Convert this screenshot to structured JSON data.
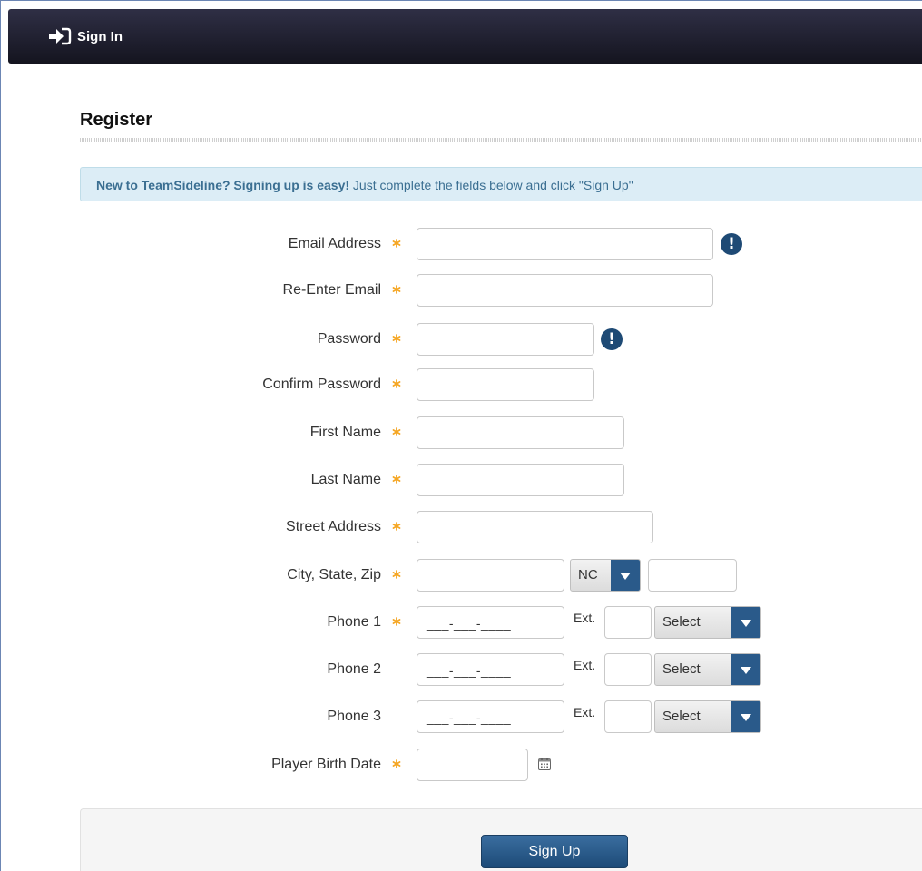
{
  "header": {
    "signin_label": "Sign In"
  },
  "page": {
    "title": "Register"
  },
  "info": {
    "bold": "New to TeamSideline? Signing up is easy!",
    "rest": " Just complete the fields below and click \"Sign Up\""
  },
  "labels": {
    "email": "Email Address",
    "reemail": "Re-Enter Email",
    "password": "Password",
    "confirm": "Confirm Password",
    "first": "First Name",
    "last": "Last Name",
    "street": "Street Address",
    "city": "City, State, Zip",
    "phone1": "Phone 1",
    "phone2": "Phone 2",
    "phone3": "Phone 3",
    "birth": "Player Birth Date",
    "ext": "Ext."
  },
  "values": {
    "state": "NC",
    "phone_mask": "___-___-____",
    "phone_type": "Select",
    "alert_glyph": "!"
  },
  "footer": {
    "signup_label": "Sign Up"
  },
  "colors": {
    "accent": "#1e4a75",
    "required": "#f5a623",
    "header_bg": "#1c1c2a",
    "info_bg": "#dcedf6"
  },
  "icons": {
    "signin": "sign-in-arrow-icon",
    "alert": "exclamation-circle-icon",
    "required": "asterisk-icon",
    "calendar": "calendar-icon"
  }
}
